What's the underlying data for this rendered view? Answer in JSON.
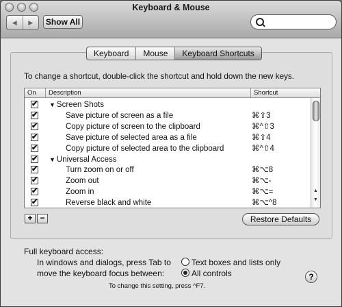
{
  "window": {
    "title": "Keyboard & Mouse"
  },
  "toolbar": {
    "show_all_label": "Show All",
    "search_placeholder": "",
    "back_icon": "left-arrow",
    "forward_icon": "right-arrow"
  },
  "tabs": [
    {
      "label": "Keyboard",
      "active": false
    },
    {
      "label": "Mouse",
      "active": false
    },
    {
      "label": "Keyboard Shortcuts",
      "active": true
    }
  ],
  "instructions": "To change a shortcut, double-click the shortcut and hold down the new keys.",
  "table": {
    "headers": {
      "on": "On",
      "description": "Description",
      "shortcut": "Shortcut"
    },
    "rows": [
      {
        "checked": true,
        "group": true,
        "description": "Screen Shots",
        "shortcut": ""
      },
      {
        "checked": true,
        "group": false,
        "description": "Save picture of screen as a file",
        "shortcut": "⌘⇧3"
      },
      {
        "checked": true,
        "group": false,
        "description": "Copy picture of screen to the clipboard",
        "shortcut": "⌘^⇧3"
      },
      {
        "checked": true,
        "group": false,
        "description": "Save picture of selected area as a file",
        "shortcut": "⌘⇧4"
      },
      {
        "checked": true,
        "group": false,
        "description": "Copy picture of selected area to the clipboard",
        "shortcut": "⌘^⇧4"
      },
      {
        "checked": true,
        "group": true,
        "description": "Universal Access",
        "shortcut": ""
      },
      {
        "checked": true,
        "group": false,
        "description": "Turn zoom on or off",
        "shortcut": "⌘⌥8"
      },
      {
        "checked": true,
        "group": false,
        "description": "Zoom out",
        "shortcut": "⌘⌥-"
      },
      {
        "checked": true,
        "group": false,
        "description": "Zoom in",
        "shortcut": "⌘⌥="
      },
      {
        "checked": true,
        "group": false,
        "description": "Reverse black and white",
        "shortcut": "⌘⌥^8"
      }
    ]
  },
  "buttons": {
    "add": "+",
    "remove": "−",
    "restore_defaults": "Restore Defaults",
    "help": "?"
  },
  "full_keyboard_access": {
    "heading": "Full keyboard access:",
    "line1": "In windows and dialogs, press Tab to",
    "line2": "move the keyboard focus between:",
    "options": [
      {
        "label": "Text boxes and lists only",
        "selected": false
      },
      {
        "label": "All controls",
        "selected": true
      }
    ],
    "note": "To change this setting, press ^F7."
  }
}
